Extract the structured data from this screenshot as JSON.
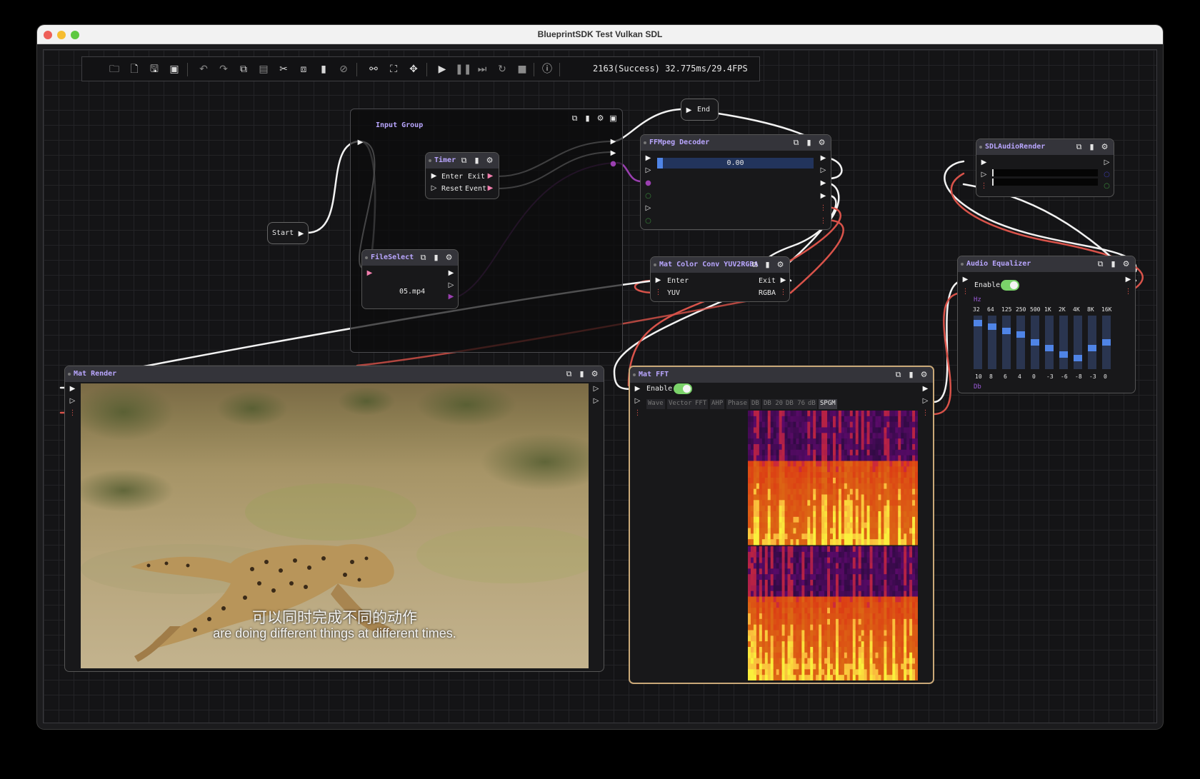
{
  "window": {
    "title": "BlueprintSDK Test Vulkan SDL"
  },
  "toolbar": {
    "icons": [
      "open-folder-icon",
      "new-file-icon",
      "save-icon",
      "save-all-icon",
      "undo-icon",
      "redo-icon",
      "copy-icon",
      "paste-icon",
      "cut-icon",
      "duplicate-icon",
      "delete-icon",
      "disable-icon",
      "unlink-icon",
      "fit-view-icon",
      "center-icon",
      "play-icon",
      "pause-icon",
      "step-icon",
      "reload-icon",
      "stop-icon",
      "info-icon"
    ],
    "status": "2163(Success) 32.775ms/29.4FPS"
  },
  "nodes": {
    "start": {
      "label": "Start"
    },
    "end": {
      "label": "End"
    },
    "input_group": {
      "title": "Input Group"
    },
    "timer": {
      "title": "Timer",
      "enter": "Enter",
      "exit": "Exit",
      "reset": "Reset",
      "event": "Event"
    },
    "file_select": {
      "title": "FileSelect",
      "file": "05.mp4"
    },
    "ffmpeg": {
      "title": "FFMpeg Decoder",
      "progress_text": "0.00",
      "progress": 0.0
    },
    "mat_color": {
      "title": "Mat Color Conv YUV2RGBA",
      "enter": "Enter",
      "exit": "Exit",
      "yuv": "YUV",
      "rgba": "RGBA"
    },
    "sdl_audio": {
      "title": "SDLAudioRender"
    },
    "audio_eq": {
      "title": "Audio Equalizer",
      "enable": "Enable",
      "hz_label": "Hz",
      "db_label": "Db",
      "bands": [
        "32",
        "64",
        "125",
        "250",
        "500",
        "1K",
        "2K",
        "4K",
        "8K",
        "16K"
      ],
      "gains": [
        "10",
        "8",
        "6",
        "4",
        "0",
        "-3",
        "-6",
        "-8",
        "-3",
        "0"
      ]
    },
    "mat_render": {
      "title": "Mat Render",
      "subtitle_cn": "可以同时完成不同的动作",
      "subtitle_en": "are doing different things at different times."
    },
    "mat_fft": {
      "title": "Mat FFT",
      "enable": "Enable",
      "tabs": [
        "Wave",
        "Vector",
        "FFT",
        "AHP",
        "Phase",
        "DB",
        "DB 20",
        "DB 76",
        "dB",
        "SPGM"
      ],
      "active_tab": "SPGM"
    }
  }
}
